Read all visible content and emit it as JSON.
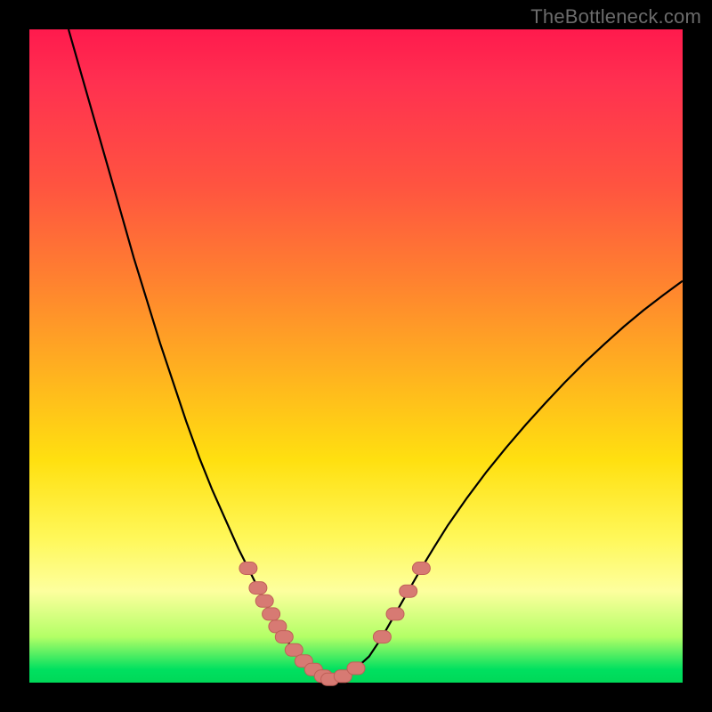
{
  "watermark": "TheBottleneck.com",
  "colors": {
    "background": "#000000",
    "gradient_top": "#ff1a4d",
    "gradient_mid_orange": "#ff8030",
    "gradient_yellow": "#ffe010",
    "gradient_pale": "#fdff9e",
    "gradient_green": "#00e060",
    "curve_stroke": "#000000",
    "marker_fill": "#d77a73",
    "marker_stroke": "#c06058",
    "watermark_text": "#6b6b6b"
  },
  "chart_data": {
    "type": "line",
    "title": "",
    "xlabel": "",
    "ylabel": "",
    "xlim": [
      0,
      100
    ],
    "ylim": [
      0,
      100
    ],
    "series": [
      {
        "name": "left-curve",
        "x": [
          6,
          8,
          10,
          12,
          14,
          16,
          18,
          20,
          22,
          24,
          26,
          28,
          30,
          32,
          33.5,
          35,
          36,
          37,
          38,
          39,
          40.5,
          42,
          43.5,
          45,
          46
        ],
        "y": [
          100,
          93,
          86,
          79,
          72,
          65,
          58.5,
          52,
          46,
          40,
          34.5,
          29.5,
          25,
          20.5,
          17.5,
          14.5,
          12.5,
          10.5,
          8.6,
          7,
          5,
          3.3,
          2,
          1,
          0.5
        ]
      },
      {
        "name": "right-curve",
        "x": [
          46,
          48,
          50,
          52,
          54,
          56,
          58,
          60,
          62,
          64,
          67,
          70,
          73,
          76,
          79,
          82,
          85,
          88,
          91,
          94,
          97,
          100
        ],
        "y": [
          0.5,
          1,
          2.2,
          4,
          7,
          10.5,
          14,
          17.5,
          20.8,
          24,
          28.3,
          32.3,
          36,
          39.5,
          42.8,
          46,
          49,
          51.8,
          54.5,
          57,
          59.3,
          61.5
        ]
      }
    ],
    "markers": [
      {
        "name": "left-cluster",
        "points": [
          [
            33.5,
            17.5
          ],
          [
            35,
            14.5
          ],
          [
            36,
            12.5
          ],
          [
            37,
            10.5
          ],
          [
            38,
            8.6
          ],
          [
            39,
            7
          ],
          [
            40.5,
            5
          ]
        ]
      },
      {
        "name": "flat-cluster",
        "points": [
          [
            42,
            3.3
          ],
          [
            43.5,
            2
          ],
          [
            45,
            1
          ],
          [
            46,
            0.5
          ],
          [
            48,
            1
          ],
          [
            50,
            2.2
          ]
        ]
      },
      {
        "name": "right-cluster",
        "points": [
          [
            54,
            7
          ],
          [
            56,
            10.5
          ],
          [
            58,
            14
          ],
          [
            60,
            17.5
          ]
        ]
      }
    ]
  }
}
